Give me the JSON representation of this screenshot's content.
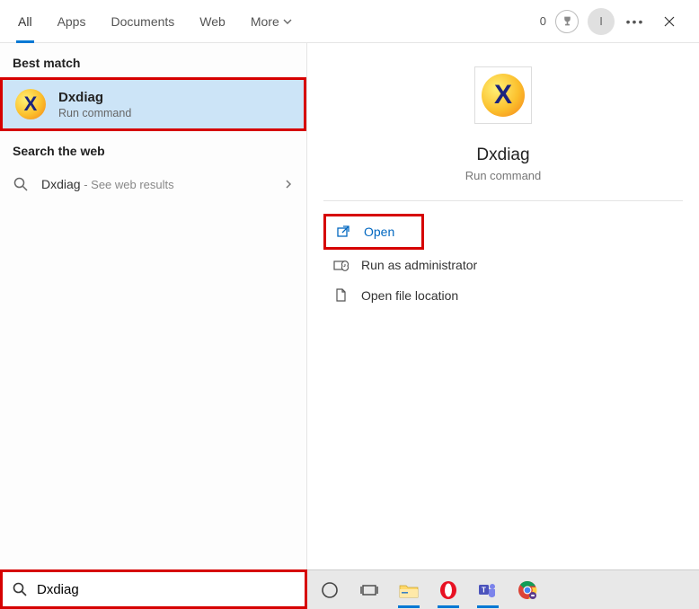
{
  "header": {
    "tabs": [
      "All",
      "Apps",
      "Documents",
      "Web",
      "More"
    ],
    "active_tab_index": 0,
    "points": "0",
    "avatar_initial": "I"
  },
  "left": {
    "best_match_label": "Best match",
    "best_match": {
      "title": "Dxdiag",
      "subtitle": "Run command"
    },
    "search_web_label": "Search the web",
    "web_result": {
      "term": "Dxdiag",
      "suffix": " - See web results"
    }
  },
  "detail": {
    "title": "Dxdiag",
    "subtitle": "Run command",
    "actions": {
      "open": "Open",
      "run_admin": "Run as administrator",
      "open_location": "Open file location"
    }
  },
  "search": {
    "value": "Dxdiag"
  }
}
